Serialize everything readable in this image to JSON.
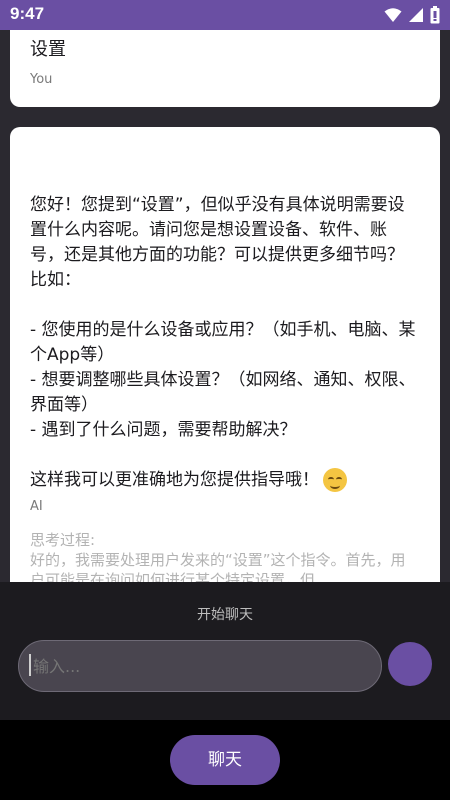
{
  "status_bar": {
    "time": "9:47",
    "icons": [
      "wifi-icon",
      "signal-icon",
      "battery-icon"
    ]
  },
  "messages": {
    "user": {
      "text": "设置",
      "sender": "You"
    },
    "ai": {
      "text": "您好！您提到“设置”，但似乎没有具体说明需要设置什么内容呢。请问您是想设置设备、软件、账号，还是其他方面的功能？可以提供更多细节吗？比如：\n\n- 您使用的是什么设备或应用？（如手机、电脑、某个App等）\n- 想要调整哪些具体设置？（如网络、通知、权限、界面等）\n- 遇到了什么问题，需要帮助解决？\n\n这样我可以更准确地为您提供指导哦！",
      "emoji": "smiling-face-icon",
      "sender": "AI",
      "thinking_title": "思考过程:",
      "thinking_text": "好的，我需要处理用户发来的“设置”这个指令。首先，用户可能是在询问如何进行某个特定设置，但"
    }
  },
  "bottom": {
    "start_chat_label": "开始聊天",
    "input_placeholder": "输入...",
    "chat_button_label": "聊天"
  },
  "colors": {
    "accent": "#6a4fa3",
    "background": "#2b2930",
    "card": "#ffffff"
  }
}
